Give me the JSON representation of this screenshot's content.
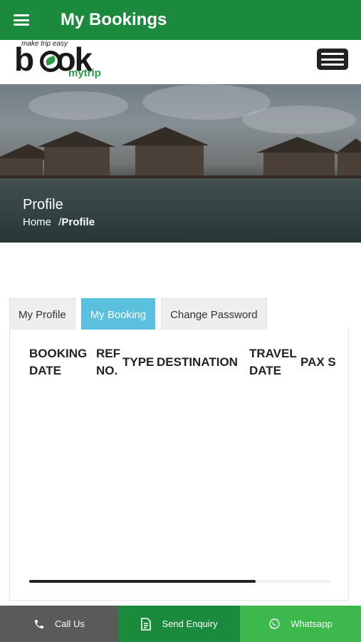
{
  "app_bar": {
    "title": "My Bookings",
    "menu_icon": "hamburger-icon"
  },
  "logo": {
    "tagline": "make trip easy",
    "word": "book",
    "sub": "mytrip"
  },
  "hero": {
    "title": "Profile",
    "crumb_home": "Home",
    "crumb_sep": "/",
    "crumb_current": "Profile"
  },
  "tabs": [
    {
      "label": "My Profile",
      "active": false
    },
    {
      "label": "My Booking",
      "active": true
    },
    {
      "label": "Change Password",
      "active": false
    }
  ],
  "table": {
    "columns": [
      {
        "line1": "BOOKING",
        "line2": "DATE"
      },
      {
        "line1": "REF",
        "line2": "NO."
      },
      {
        "line1": "TYPE",
        "line2": ""
      },
      {
        "line1": "DESTINATION",
        "line2": ""
      },
      {
        "line1": "TRAVEL",
        "line2": "DATE"
      },
      {
        "line1": "PAX S",
        "line2": ""
      }
    ],
    "scroll_position": 0.75
  },
  "bottom_bar": {
    "call": "Call Us",
    "enquiry": "Send Enquiry",
    "whatsapp": "Whatsapp"
  },
  "colors": {
    "primary": "#1c8a3c",
    "tab_active": "#5bc0de",
    "whatsapp": "#3db84d",
    "call": "#5a5a5a"
  }
}
